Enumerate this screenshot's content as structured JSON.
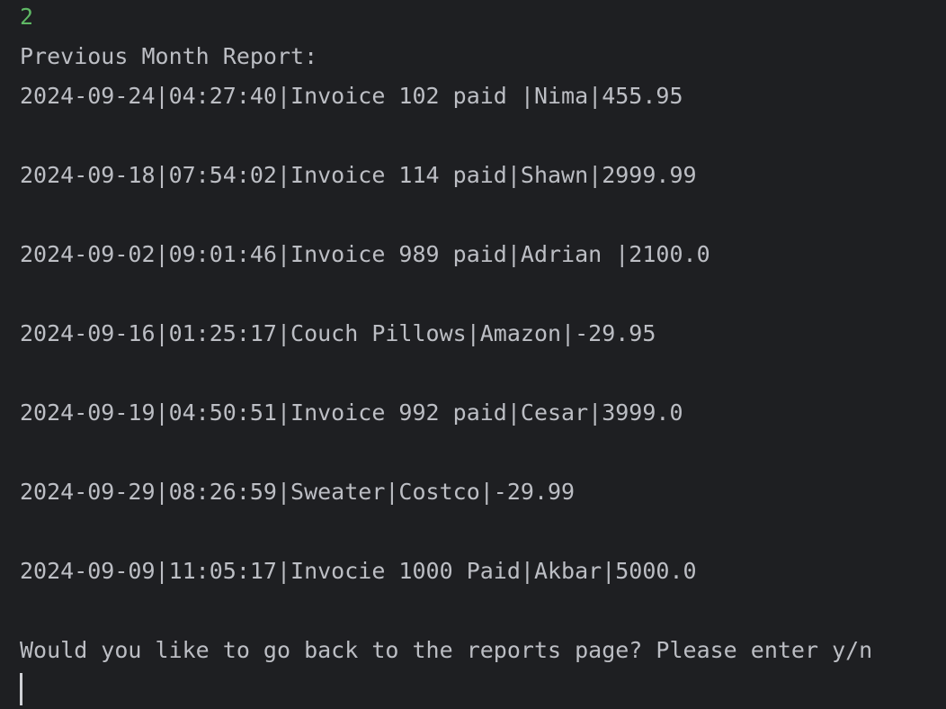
{
  "console": {
    "user_input": "2",
    "header": "Previous Month Report:",
    "entries": [
      "2024-09-24|04:27:40|Invoice 102 paid |Nima|455.95",
      "2024-09-18|07:54:02|Invoice 114 paid|Shawn|2999.99",
      "2024-09-02|09:01:46|Invoice 989 paid|Adrian |2100.0",
      "2024-09-16|01:25:17|Couch Pillows|Amazon|-29.95",
      "2024-09-19|04:50:51|Invoice 992 paid|Cesar|3999.0",
      "2024-09-29|08:26:59|Sweater|Costco|-29.99",
      "2024-09-09|11:05:17|Invocie 1000 Paid|Akbar|5000.0"
    ],
    "prompt": "Would you like to go back to the reports page? Please enter y/n"
  },
  "colors": {
    "background": "#1e1f22",
    "text": "#bcbec4",
    "user_input": "#5fb865"
  }
}
